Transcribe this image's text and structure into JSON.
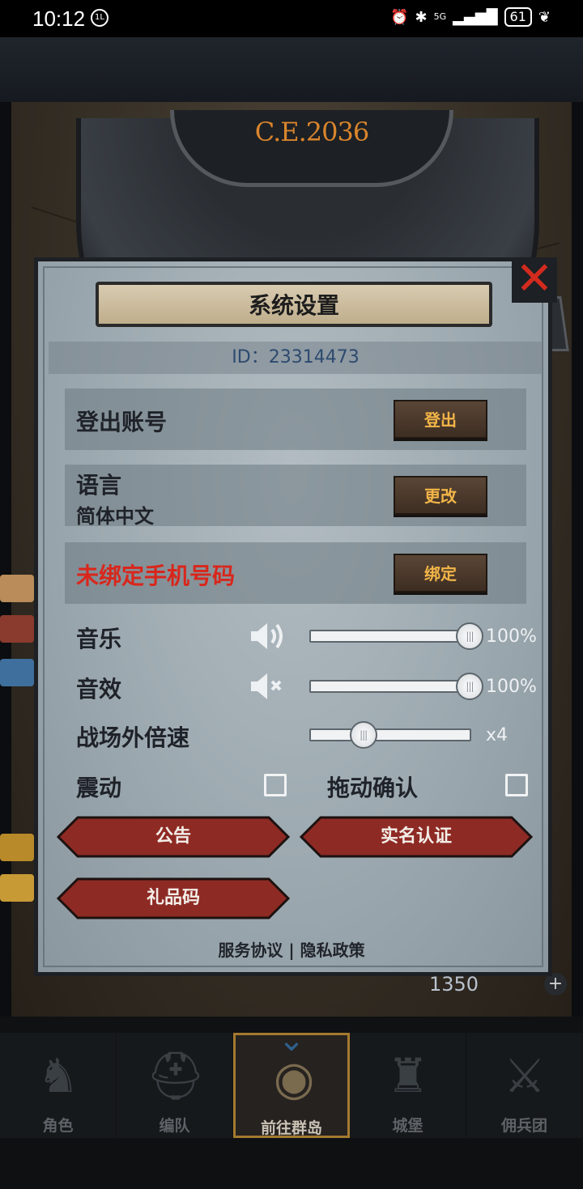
{
  "status_bar": {
    "time": "10:12",
    "badge": "1L",
    "network": "5G",
    "battery": "61"
  },
  "game": {
    "year": "C.E.2036",
    "currency_value": "1350"
  },
  "dialog": {
    "title": "系统设置",
    "id_text": "ID：23314473",
    "logout": {
      "label": "登出账号",
      "button": "登出"
    },
    "language": {
      "label": "语言",
      "value": "简体中文",
      "button": "更改"
    },
    "phone": {
      "label": "未绑定手机号码",
      "button": "绑定"
    },
    "music": {
      "label": "音乐",
      "value_text": "100%",
      "level": 1.0
    },
    "sfx": {
      "label": "音效",
      "value_text": "100%",
      "level": 1.0
    },
    "speed": {
      "label": "战场外倍速",
      "value_text": "x4",
      "level": 0.33
    },
    "vibration": {
      "label": "震动",
      "checked": false
    },
    "drag_confirm": {
      "label": "拖动确认",
      "checked": false
    },
    "buttons": {
      "notice": "公告",
      "real_name": "实名认证",
      "gift_code": "礼品码"
    },
    "footer": {
      "terms": "服务协议",
      "separator": "|",
      "privacy": "隐私政策"
    }
  },
  "nav": [
    {
      "label": "角色",
      "icon": "knight-icon",
      "active": false
    },
    {
      "label": "编队",
      "icon": "helmet-icon",
      "active": false
    },
    {
      "label": "前往群岛",
      "icon": "globe-icon",
      "active": true
    },
    {
      "label": "城堡",
      "icon": "castle-icon",
      "active": false
    },
    {
      "label": "佣兵团",
      "icon": "sword-icon",
      "active": false
    }
  ],
  "colors": {
    "accent_orange": "#f2b548",
    "warning_red": "#d9261b",
    "panel": "#9aa6ae",
    "button_red": "#8e2a24"
  }
}
